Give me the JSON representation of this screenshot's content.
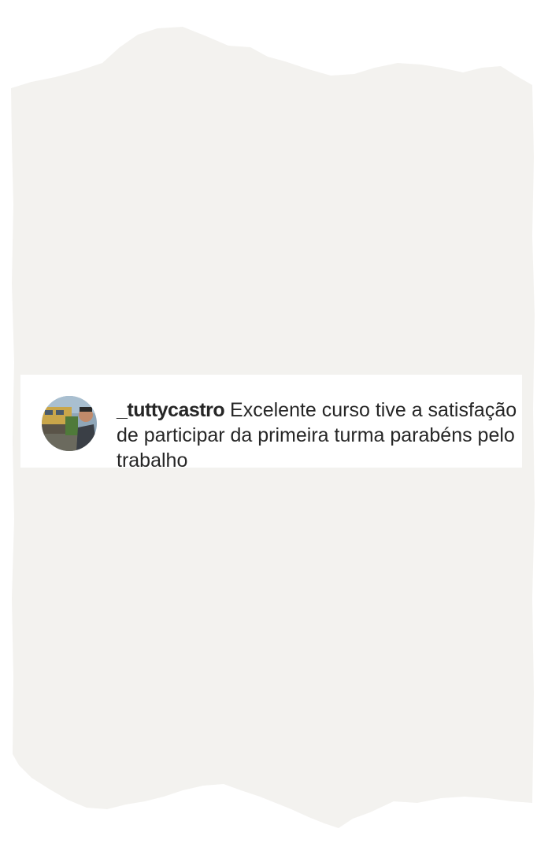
{
  "comment": {
    "username": "_tuttycastro",
    "text": "Excelente curso tive a satisfação de participar da primeira turma parabéns pelo trabalho"
  },
  "colors": {
    "paper": "#f3f2ef",
    "card": "#ffffff",
    "text": "#262626"
  }
}
